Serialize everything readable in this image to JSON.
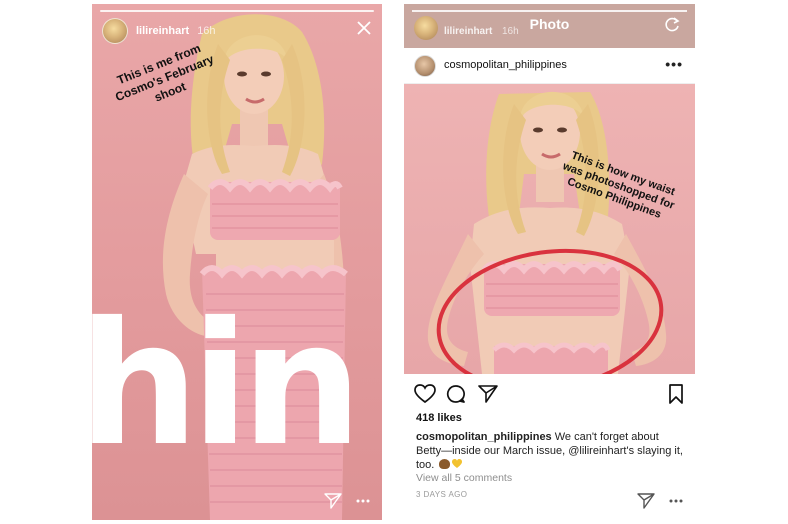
{
  "story": {
    "username": "lilireinhart",
    "time": "16h",
    "caption": "This is me from Cosmo's February shoot",
    "big_word": "hin"
  },
  "photo_view": {
    "title": "Photo",
    "overlay_username": "lilireinhart",
    "overlay_time": "16h",
    "post": {
      "username": "cosmopolitan_philippines",
      "more": "•••",
      "image_caption": "This is how my waist was photoshopped for Cosmo Philippines",
      "likes": "418 likes",
      "comment_user": "cosmopolitan_philippines",
      "comment_text": " We can't forget about Betty—inside our March issue, @lilireinhart's slaying it, too.",
      "view_comments": "View all 5 comments",
      "timestamp": "3 DAYS AGO"
    }
  },
  "colors": {
    "story_bg": "#e39b9d",
    "circle": "#d9323e",
    "text_dark": "#111111"
  },
  "icons": [
    "close-icon",
    "send-icon",
    "more-icon",
    "heart-icon",
    "comment-icon",
    "bookmark-icon",
    "refresh-icon"
  ]
}
